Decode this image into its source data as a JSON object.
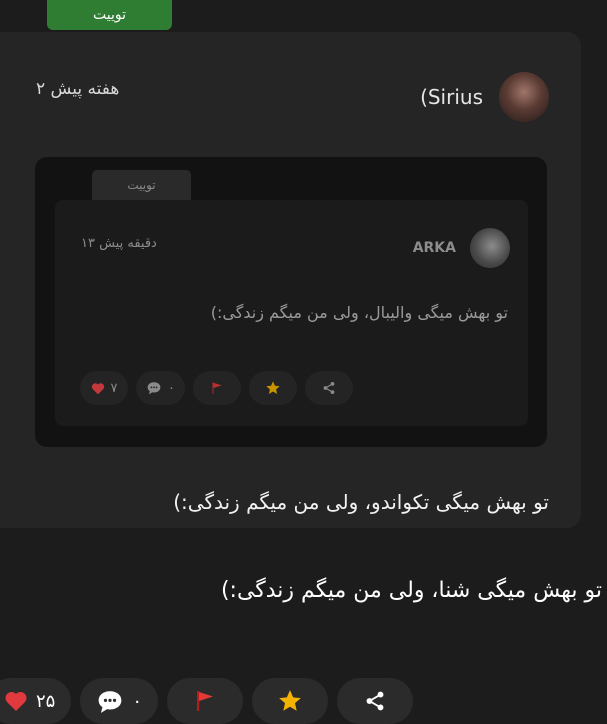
{
  "outer": {
    "tab_label": "توییت",
    "author_name": "(Sirius",
    "time": "۲ هفته پیش",
    "text": "تو بهش میگی تکواندو، ولی من میگم زندگی:)",
    "quoted": {
      "tab_label": "توییت",
      "author_name": "ARKA",
      "time": "۱۳ دقیقه پیش",
      "text": "تو بهش میگی والیبال، ولی من میگم زندگی:)",
      "likes": "۷",
      "comments": "۰"
    }
  },
  "main": {
    "text": "تو بهش میگی شنا، ولی من میگم زندگی:)",
    "likes": "۲۵",
    "comments": "۰"
  },
  "icons": {
    "like": "heart-icon",
    "comment": "comment-bubble-icon",
    "report": "flag-icon",
    "favorite": "star-icon",
    "share": "share-icon"
  },
  "colors": {
    "badge": "#2f7d32",
    "heart": "#e0393e",
    "flag": "#d32f2f",
    "star": "#f5b301"
  }
}
